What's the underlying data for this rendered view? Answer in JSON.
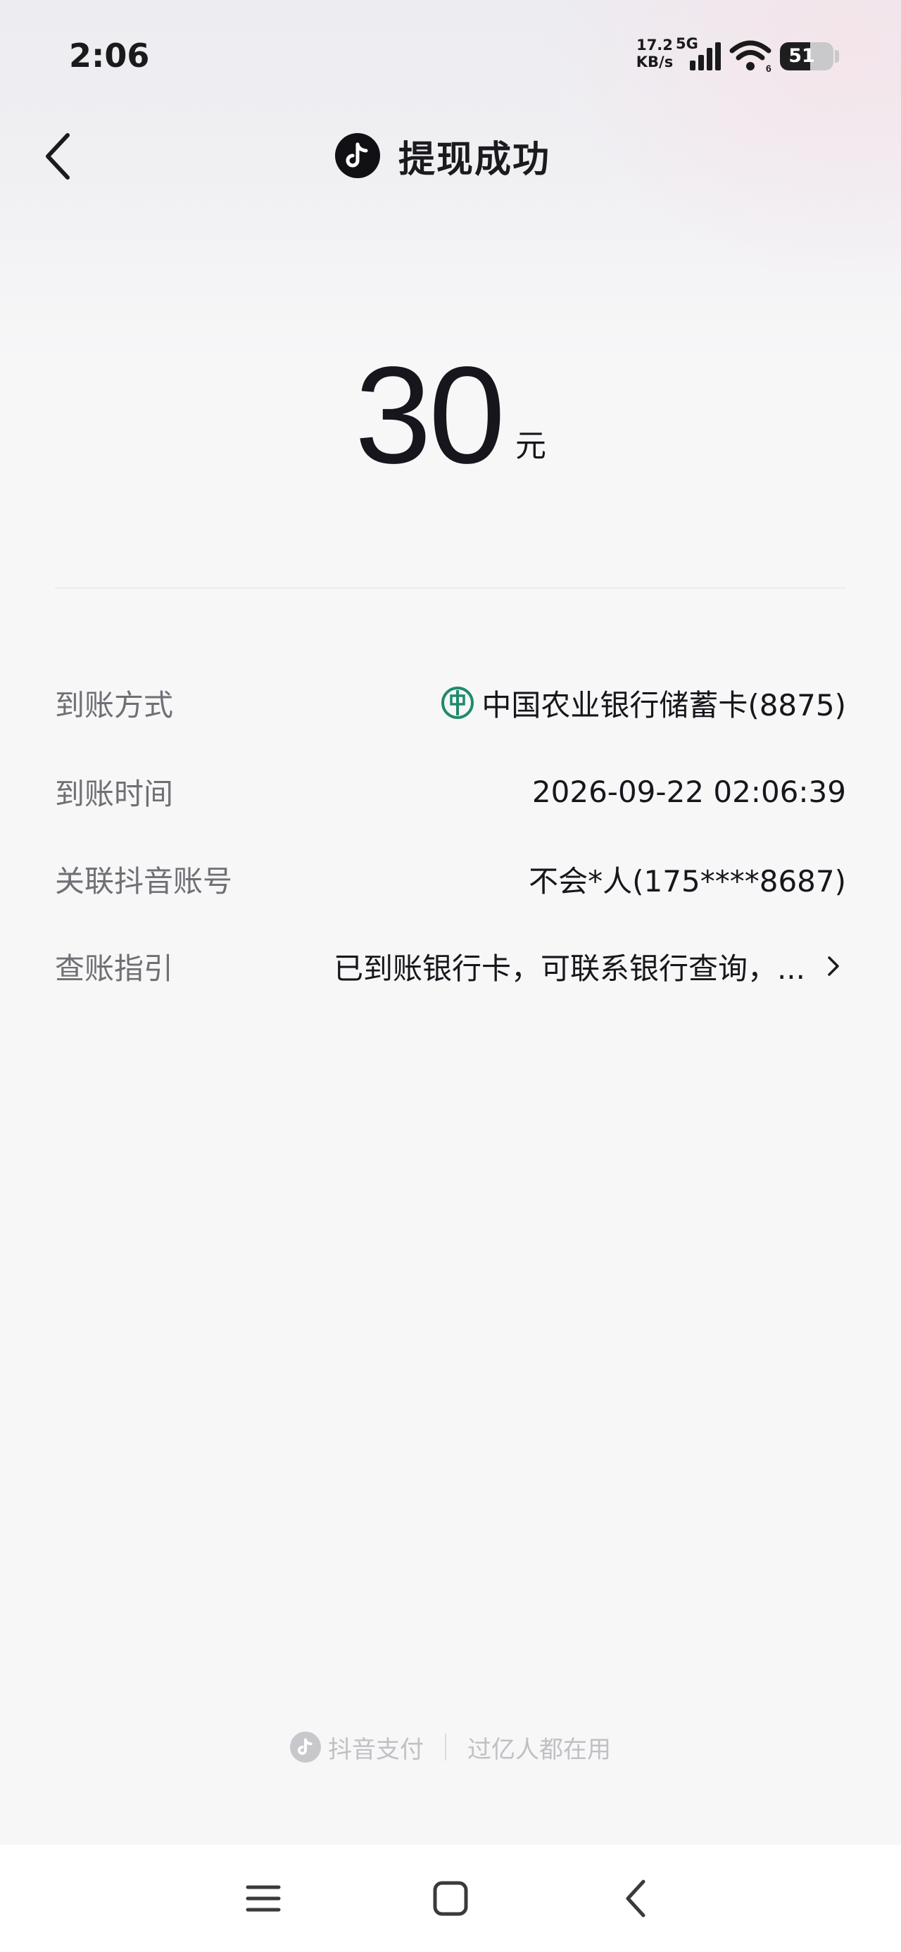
{
  "status_bar": {
    "time": "2:06",
    "net_speed_value": "17.2",
    "net_speed_unit": "KB/s",
    "network_type": "5G",
    "wifi_badge": "6",
    "battery_level": "51",
    "battery_percent": 51
  },
  "header": {
    "back_icon": "chevron-left-icon",
    "logo_icon": "douyin-logo-icon",
    "title": "提现成功"
  },
  "amount": {
    "value": "30",
    "unit": "元"
  },
  "details": [
    {
      "label": "到账方式",
      "value": "中国农业银行储蓄卡(8875)",
      "icon": "abc-bank-icon"
    },
    {
      "label": "到账时间",
      "value": "2026-09-22 02:06:39"
    },
    {
      "label": "关联抖音账号",
      "value": "不会*人(175****8687)"
    },
    {
      "label": "查账指引",
      "value": "已到账银行卡，可联系银行查询，...",
      "icon": "chevron-right-icon"
    }
  ],
  "footer": {
    "brand": "抖音支付",
    "slogan": "过亿人都在用"
  },
  "nav": {
    "menu_icon": "menu-icon",
    "home_icon": "home-square-icon",
    "back_icon": "back-triangle-icon"
  },
  "colors": {
    "background": "#f7f7f8",
    "text_primary": "#16161c",
    "text_secondary": "#6f6f75",
    "bank_green": "#1f8a6c",
    "footer_gray": "#c0c0c4"
  }
}
